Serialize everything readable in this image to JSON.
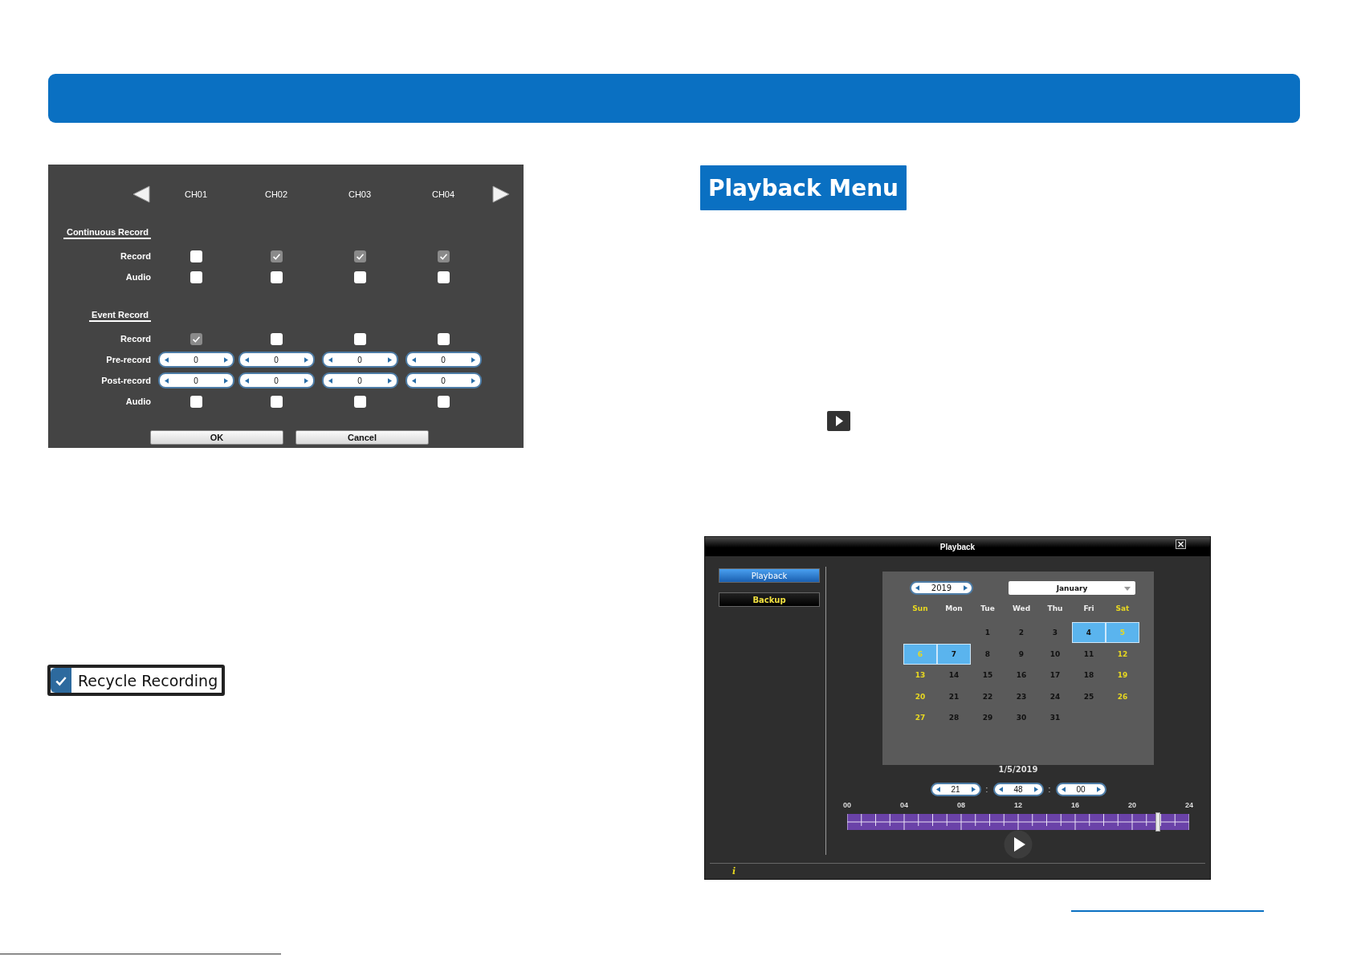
{
  "record_settings": {
    "channels": [
      "CH01",
      "CH02",
      "CH03",
      "CH04"
    ],
    "sections": [
      {
        "title": "Continuous Record",
        "rows": [
          {
            "kind": "checkbox",
            "label": "Record",
            "cells": [
              {
                "checked": false
              },
              {
                "checked": true
              },
              {
                "checked": true
              },
              {
                "checked": true
              }
            ]
          },
          {
            "kind": "checkbox",
            "label": "Audio",
            "cells": [
              {
                "checked": false
              },
              {
                "checked": false
              },
              {
                "checked": false
              },
              {
                "checked": false
              }
            ]
          }
        ]
      },
      {
        "title": "Event Record",
        "rows": [
          {
            "kind": "checkbox",
            "label": "Record",
            "cells": [
              {
                "checked": true
              },
              {
                "checked": false
              },
              {
                "checked": false
              },
              {
                "checked": false
              }
            ]
          },
          {
            "kind": "spinner",
            "label": "Pre-record",
            "values": [
              "0",
              "0",
              "0",
              "0"
            ]
          },
          {
            "kind": "spinner",
            "label": "Post-record",
            "values": [
              "0",
              "0",
              "0",
              "0"
            ]
          },
          {
            "kind": "checkbox",
            "label": "Audio",
            "cells": [
              {
                "checked": false
              },
              {
                "checked": false
              },
              {
                "checked": false
              },
              {
                "checked": false
              }
            ]
          }
        ]
      }
    ],
    "buttons": [
      "OK",
      "Cancel"
    ]
  },
  "playback_heading": "Playback Menu",
  "recycle_recording": {
    "label": "Recycle Recording",
    "checked": true
  },
  "playback_window": {
    "title": "Playback",
    "sidebar": [
      {
        "label": "Playback",
        "selected": true
      },
      {
        "label": "Backup",
        "selected": false
      }
    ],
    "calendar": {
      "year": "2019",
      "month": "January",
      "weekdays": [
        {
          "label": "Sun",
          "weekend": true
        },
        {
          "label": "Mon",
          "weekend": false
        },
        {
          "label": "Tue",
          "weekend": false
        },
        {
          "label": "Wed",
          "weekend": false
        },
        {
          "label": "Thu",
          "weekend": false
        },
        {
          "label": "Fri",
          "weekend": false
        },
        {
          "label": "Sat",
          "weekend": true
        }
      ],
      "weeks": [
        [
          {
            "kind": "blank"
          },
          {
            "kind": "blank"
          },
          {
            "day": "1",
            "recorded": false
          },
          {
            "day": "2",
            "recorded": false
          },
          {
            "day": "3",
            "recorded": false
          },
          {
            "day": "4",
            "recorded": true
          },
          {
            "day": "5",
            "recorded": true
          }
        ],
        [
          {
            "day": "6",
            "recorded": true
          },
          {
            "day": "7",
            "recorded": true
          },
          {
            "day": "8",
            "recorded": false
          },
          {
            "day": "9",
            "recorded": false
          },
          {
            "day": "10",
            "recorded": false
          },
          {
            "day": "11",
            "recorded": false
          },
          {
            "day": "12",
            "recorded": false
          }
        ],
        [
          {
            "day": "13",
            "recorded": false
          },
          {
            "day": "14",
            "recorded": false
          },
          {
            "day": "15",
            "recorded": false
          },
          {
            "day": "16",
            "recorded": false
          },
          {
            "day": "17",
            "recorded": false
          },
          {
            "day": "18",
            "recorded": false
          },
          {
            "day": "19",
            "recorded": false
          }
        ],
        [
          {
            "day": "20",
            "recorded": false
          },
          {
            "day": "21",
            "recorded": false
          },
          {
            "day": "22",
            "recorded": false
          },
          {
            "day": "23",
            "recorded": false
          },
          {
            "day": "24",
            "recorded": false
          },
          {
            "day": "25",
            "recorded": false
          },
          {
            "day": "26",
            "recorded": false
          }
        ],
        [
          {
            "day": "27",
            "recorded": false
          },
          {
            "day": "28",
            "recorded": false
          },
          {
            "day": "29",
            "recorded": false
          },
          {
            "day": "30",
            "recorded": false
          },
          {
            "day": "31",
            "recorded": false
          }
        ]
      ]
    },
    "date": "1/5/2019",
    "time": [
      {
        "value": "21",
        "separator": ":"
      },
      {
        "value": "48",
        "separator": ":"
      },
      {
        "value": "00"
      }
    ],
    "timeline": {
      "labels": [
        "00",
        "04",
        "08",
        "12",
        "16",
        "20",
        "24"
      ],
      "level": 0.908
    },
    "status": "i"
  }
}
